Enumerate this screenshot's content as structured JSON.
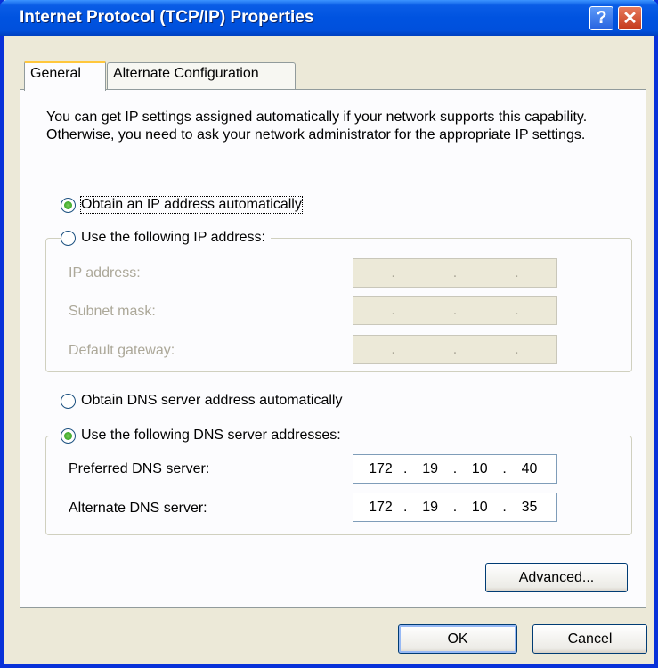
{
  "window": {
    "title": "Internet Protocol (TCP/IP) Properties",
    "help_label": "?",
    "close_label": "✕"
  },
  "tabs": [
    {
      "label": "General",
      "selected": true
    },
    {
      "label": "Alternate Configuration",
      "selected": false
    }
  ],
  "intro_text": "You can get IP settings assigned automatically if your network supports this capability. Otherwise, you need to ask your network administrator for the appropriate IP settings.",
  "ip_section": {
    "obtain_auto_label": "Obtain an IP address automatically",
    "obtain_auto_checked": true,
    "use_following_label": "Use the following IP address:",
    "use_following_checked": false,
    "ip_address_label": "IP address:",
    "subnet_mask_label": "Subnet mask:",
    "default_gateway_label": "Default gateway:",
    "empty_dot": "."
  },
  "dns_section": {
    "obtain_auto_label": "Obtain DNS server address automatically",
    "obtain_auto_checked": false,
    "use_following_label": "Use the following DNS server addresses:",
    "use_following_checked": true,
    "preferred_label": "Preferred DNS server:",
    "preferred_octets": [
      "172",
      "19",
      "10",
      "40"
    ],
    "alternate_label": "Alternate DNS server:",
    "alternate_octets": [
      "172",
      "19",
      "10",
      "35"
    ],
    "dot": "."
  },
  "buttons": {
    "advanced": "Advanced...",
    "ok": "OK",
    "cancel": "Cancel"
  }
}
